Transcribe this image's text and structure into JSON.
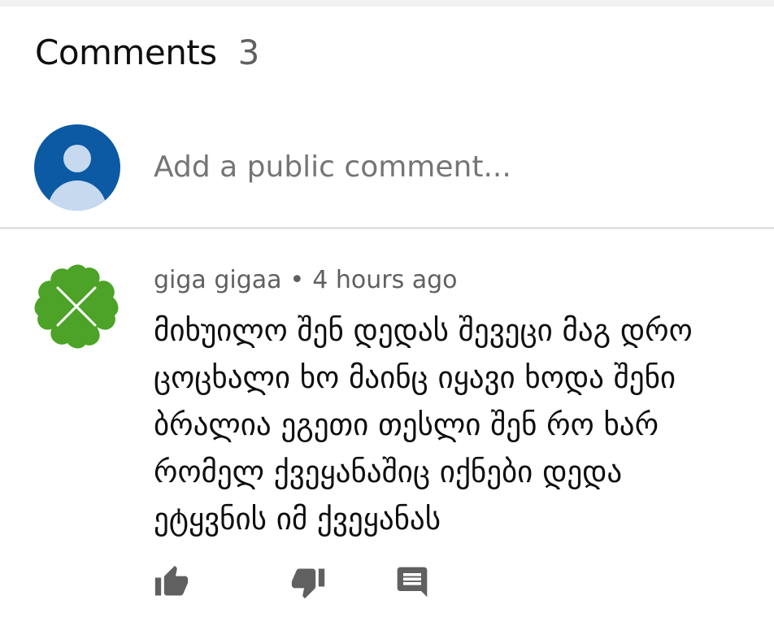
{
  "comments_section": {
    "title": "Comments",
    "count": "3"
  },
  "add_comment": {
    "placeholder": "Add a public comment..."
  },
  "comment": {
    "author": "giga gigaa",
    "separator": "•",
    "time": "4 hours ago",
    "text": "მიხუილო შენ დედას შევეცი მაგ დრო\nცოცხალი ხო მაინც იყავი ხოდა შენი\nბრალია ეგეთი თესლი შენ რო ხარ\nრომელ ქვეყანაშიც იქნები დედა\nეტყვნის იმ ქვეყანას",
    "actions": {
      "like_icon": "thumb-up-icon",
      "dislike_icon": "thumb-down-icon",
      "reply_icon": "comment-icon"
    }
  },
  "colors": {
    "avatar_blue": "#0b5aa3",
    "clover_green": "#4ca327",
    "icon_gray": "#606060"
  }
}
